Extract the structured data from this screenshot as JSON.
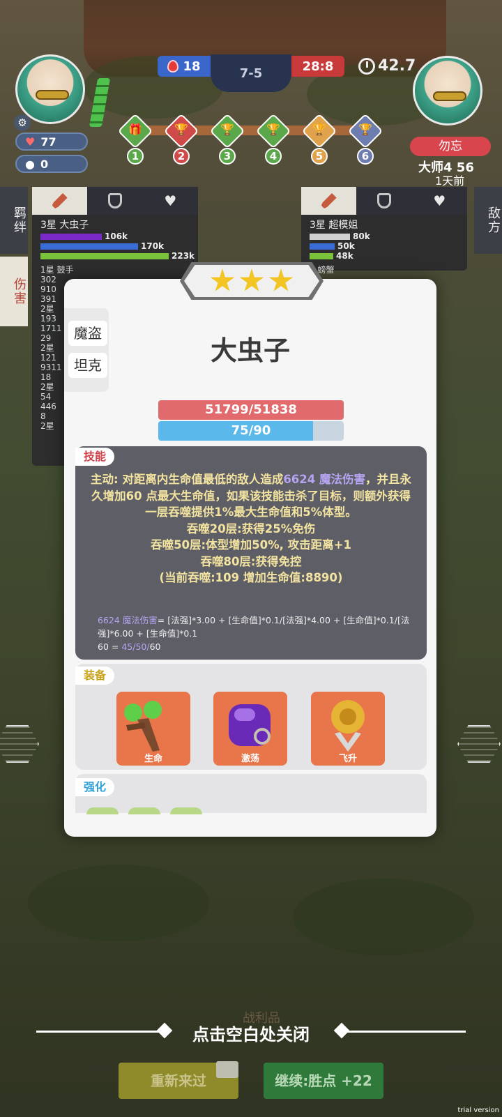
{
  "hud": {
    "health": "77",
    "gold": "0",
    "blue_score": "18",
    "round_score": "7-5",
    "red_score": "28:8",
    "timer": "42.7",
    "rounds": [
      "1",
      "2",
      "3",
      "4",
      "5",
      "6"
    ],
    "opponent": {
      "name": "勿忘",
      "rank": "大师4 56",
      "last_seen": "1天前"
    }
  },
  "side_tabs": {
    "bonds": "羁绊",
    "damage": "伤害",
    "enemy": "敌方"
  },
  "left_panel": {
    "unit_title": "3星 大虫子",
    "bars": [
      "106k",
      "170k",
      "223k"
    ],
    "list": [
      "1星 鼓手",
      "302",
      "910",
      "391",
      "2星",
      "193",
      "1711",
      "29",
      "2星",
      "121",
      "9311",
      "18",
      "2星",
      "54",
      "446",
      "8",
      "2星"
    ]
  },
  "right_panel": {
    "unit_title": "3星 超模姐",
    "bars": [
      "80k",
      "50k",
      "48k"
    ],
    "list": [
      "1 螃蟹"
    ]
  },
  "modal": {
    "traits": [
      "魔盗",
      "坦克"
    ],
    "unit_name": "大虫子",
    "hp": "51799/51838",
    "mp": "75/90",
    "mp_fraction": 0.833,
    "skill_tag": "技能",
    "skill_line1_prefix": "主动: 对距离内生命值最低的敌人造成",
    "skill_line1_hl": "6624 魔法伤害",
    "skill_rest": "，并且永久增加60 点最大生命值，如果该技能击杀了目标，则额外获得一层吞噬提供1%最大生命值和5%体型。",
    "skill_stack1": "吞噬20层:获得25%免伤",
    "skill_stack2": "吞噬50层:体型增加50%, 攻击距离+1",
    "skill_stack3": "吞噬80层:获得免控",
    "skill_current": "(当前吞噬:109 增加生命值:8890)",
    "formula_hl": "6624 魔法伤害",
    "formula_rest": "= [法强]*3.00 + [生命值]*0.1/[法强]*4.00 + [生命值]*0.1/[法强]*6.00 + [生命值]*0.1",
    "formula2_prefix": "60 = ",
    "formula2_hl": "45/50/",
    "formula2_end": "60",
    "equip_tag": "装备",
    "equips": [
      "生命",
      "激荡",
      "飞升"
    ],
    "enhance_tag": "强化"
  },
  "bottom": {
    "loot": "战利品",
    "close_hint": "点击空白处关闭",
    "retry": "重新来过",
    "continue": "继续:胜点 +22"
  },
  "watermark": "trial version"
}
